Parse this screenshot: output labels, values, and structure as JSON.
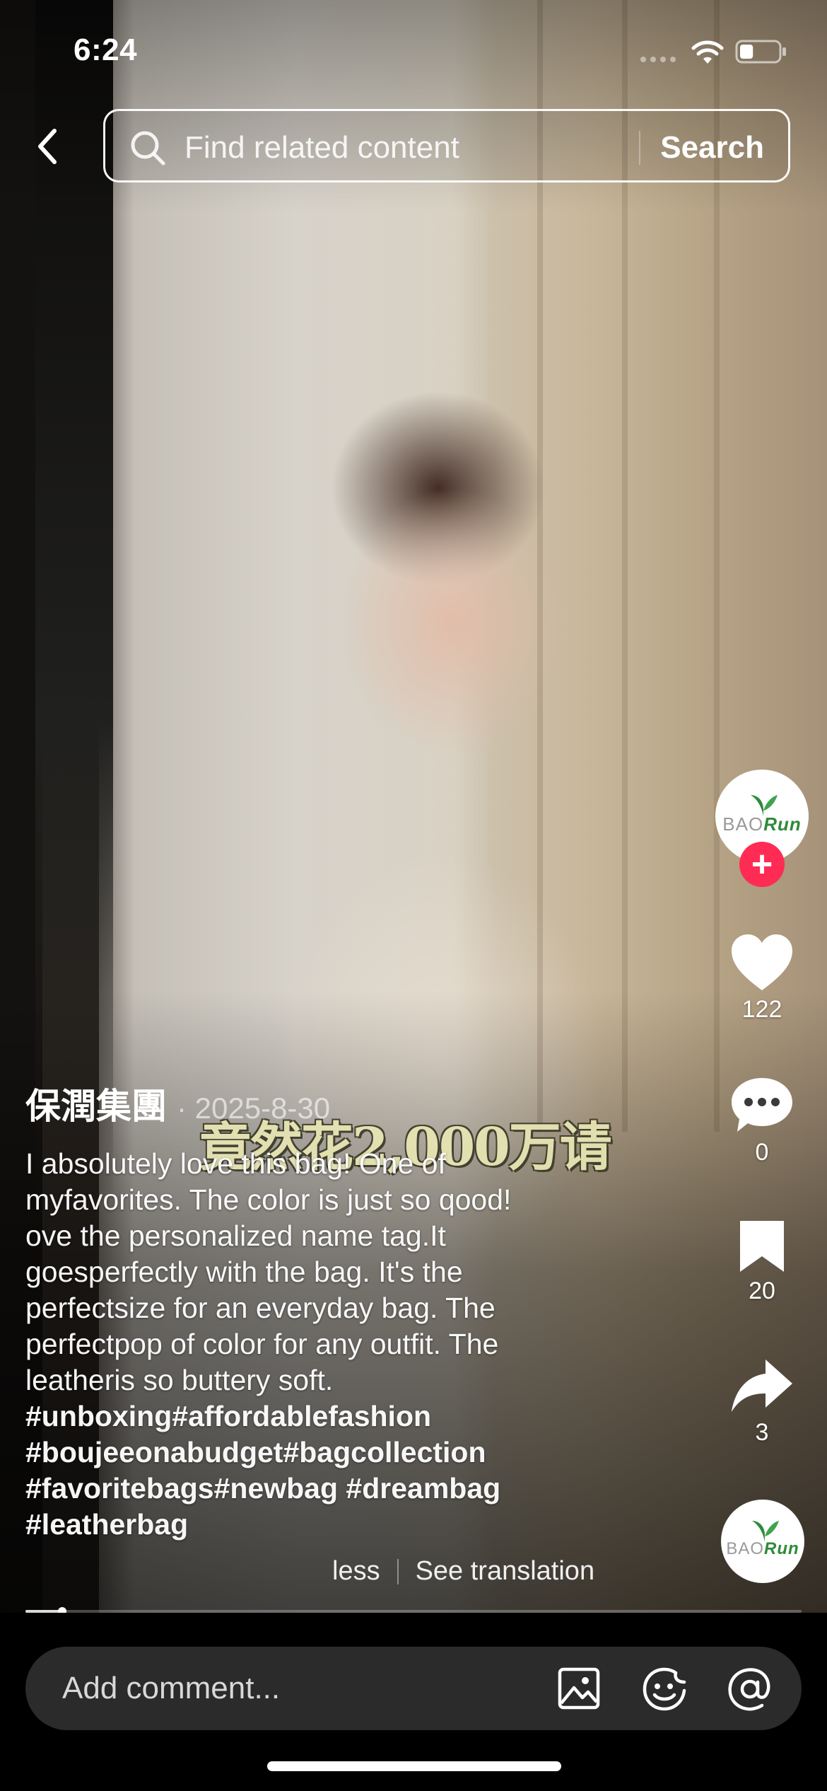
{
  "status_bar": {
    "time": "6:24",
    "battery_level": 0.35
  },
  "header": {
    "back_icon": "chevron-left-icon",
    "search_placeholder": "Find related content",
    "search_button": "Search"
  },
  "rail": {
    "avatar_logo": {
      "line1": "BAO",
      "line2": "Run"
    },
    "follow_label": "+",
    "likes": "122",
    "comments": "0",
    "saves": "20",
    "shares": "3"
  },
  "post": {
    "author": "保潤集團",
    "date": "· 2025-8-30",
    "subtitle_overlay": "竟然花2,000万请",
    "caption_lines": [
      "I absolutely love this bag! One of",
      "myfavorites. The color is just so qood!",
      "ove the personalized name tag.It",
      "goesperfectly with the bag. It's the",
      "perfectsize for an everyday bag. The",
      "perfectpop of color for any outfit. The",
      "leatheris so buttery soft."
    ],
    "hashtag_lines": [
      "#unboxing#affordablefashion",
      "#boujeeonabudget#bagcollection",
      "#favoritebags#newbag #dreambag",
      "#leatherbag"
    ],
    "less_label": "less",
    "translate_label": "See translation"
  },
  "playback": {
    "progress": 0.047
  },
  "comment_bar": {
    "placeholder": "Add comment...",
    "icons": [
      "image-icon",
      "sticker-icon",
      "mention-icon"
    ]
  },
  "colors": {
    "accent": "#fe2c55",
    "comment_box": "#2b2b2b",
    "brand_green": "#2e8b3a"
  }
}
